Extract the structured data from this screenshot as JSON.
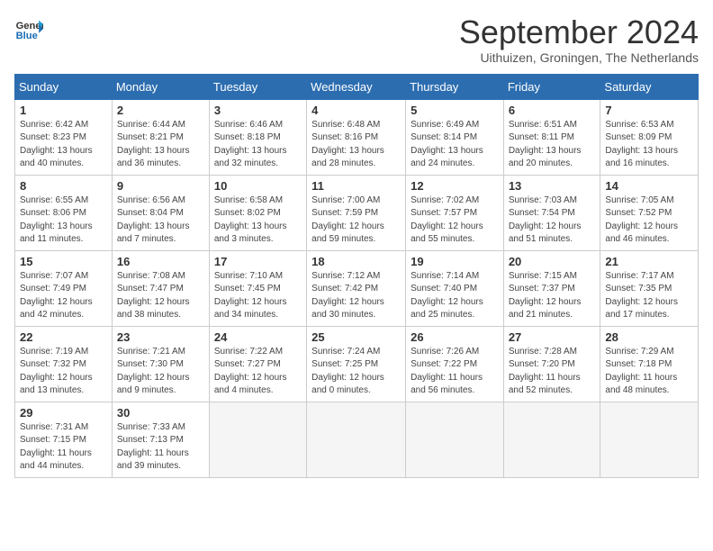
{
  "header": {
    "logo_line1": "General",
    "logo_line2": "Blue",
    "month_year": "September 2024",
    "location": "Uithuizen, Groningen, The Netherlands"
  },
  "days_of_week": [
    "Sunday",
    "Monday",
    "Tuesday",
    "Wednesday",
    "Thursday",
    "Friday",
    "Saturday"
  ],
  "weeks": [
    [
      {
        "day": 1,
        "detail": "Sunrise: 6:42 AM\nSunset: 8:23 PM\nDaylight: 13 hours\nand 40 minutes."
      },
      {
        "day": 2,
        "detail": "Sunrise: 6:44 AM\nSunset: 8:21 PM\nDaylight: 13 hours\nand 36 minutes."
      },
      {
        "day": 3,
        "detail": "Sunrise: 6:46 AM\nSunset: 8:18 PM\nDaylight: 13 hours\nand 32 minutes."
      },
      {
        "day": 4,
        "detail": "Sunrise: 6:48 AM\nSunset: 8:16 PM\nDaylight: 13 hours\nand 28 minutes."
      },
      {
        "day": 5,
        "detail": "Sunrise: 6:49 AM\nSunset: 8:14 PM\nDaylight: 13 hours\nand 24 minutes."
      },
      {
        "day": 6,
        "detail": "Sunrise: 6:51 AM\nSunset: 8:11 PM\nDaylight: 13 hours\nand 20 minutes."
      },
      {
        "day": 7,
        "detail": "Sunrise: 6:53 AM\nSunset: 8:09 PM\nDaylight: 13 hours\nand 16 minutes."
      }
    ],
    [
      {
        "day": 8,
        "detail": "Sunrise: 6:55 AM\nSunset: 8:06 PM\nDaylight: 13 hours\nand 11 minutes."
      },
      {
        "day": 9,
        "detail": "Sunrise: 6:56 AM\nSunset: 8:04 PM\nDaylight: 13 hours\nand 7 minutes."
      },
      {
        "day": 10,
        "detail": "Sunrise: 6:58 AM\nSunset: 8:02 PM\nDaylight: 13 hours\nand 3 minutes."
      },
      {
        "day": 11,
        "detail": "Sunrise: 7:00 AM\nSunset: 7:59 PM\nDaylight: 12 hours\nand 59 minutes."
      },
      {
        "day": 12,
        "detail": "Sunrise: 7:02 AM\nSunset: 7:57 PM\nDaylight: 12 hours\nand 55 minutes."
      },
      {
        "day": 13,
        "detail": "Sunrise: 7:03 AM\nSunset: 7:54 PM\nDaylight: 12 hours\nand 51 minutes."
      },
      {
        "day": 14,
        "detail": "Sunrise: 7:05 AM\nSunset: 7:52 PM\nDaylight: 12 hours\nand 46 minutes."
      }
    ],
    [
      {
        "day": 15,
        "detail": "Sunrise: 7:07 AM\nSunset: 7:49 PM\nDaylight: 12 hours\nand 42 minutes."
      },
      {
        "day": 16,
        "detail": "Sunrise: 7:08 AM\nSunset: 7:47 PM\nDaylight: 12 hours\nand 38 minutes."
      },
      {
        "day": 17,
        "detail": "Sunrise: 7:10 AM\nSunset: 7:45 PM\nDaylight: 12 hours\nand 34 minutes."
      },
      {
        "day": 18,
        "detail": "Sunrise: 7:12 AM\nSunset: 7:42 PM\nDaylight: 12 hours\nand 30 minutes."
      },
      {
        "day": 19,
        "detail": "Sunrise: 7:14 AM\nSunset: 7:40 PM\nDaylight: 12 hours\nand 25 minutes."
      },
      {
        "day": 20,
        "detail": "Sunrise: 7:15 AM\nSunset: 7:37 PM\nDaylight: 12 hours\nand 21 minutes."
      },
      {
        "day": 21,
        "detail": "Sunrise: 7:17 AM\nSunset: 7:35 PM\nDaylight: 12 hours\nand 17 minutes."
      }
    ],
    [
      {
        "day": 22,
        "detail": "Sunrise: 7:19 AM\nSunset: 7:32 PM\nDaylight: 12 hours\nand 13 minutes."
      },
      {
        "day": 23,
        "detail": "Sunrise: 7:21 AM\nSunset: 7:30 PM\nDaylight: 12 hours\nand 9 minutes."
      },
      {
        "day": 24,
        "detail": "Sunrise: 7:22 AM\nSunset: 7:27 PM\nDaylight: 12 hours\nand 4 minutes."
      },
      {
        "day": 25,
        "detail": "Sunrise: 7:24 AM\nSunset: 7:25 PM\nDaylight: 12 hours\nand 0 minutes."
      },
      {
        "day": 26,
        "detail": "Sunrise: 7:26 AM\nSunset: 7:22 PM\nDaylight: 11 hours\nand 56 minutes."
      },
      {
        "day": 27,
        "detail": "Sunrise: 7:28 AM\nSunset: 7:20 PM\nDaylight: 11 hours\nand 52 minutes."
      },
      {
        "day": 28,
        "detail": "Sunrise: 7:29 AM\nSunset: 7:18 PM\nDaylight: 11 hours\nand 48 minutes."
      }
    ],
    [
      {
        "day": 29,
        "detail": "Sunrise: 7:31 AM\nSunset: 7:15 PM\nDaylight: 11 hours\nand 44 minutes."
      },
      {
        "day": 30,
        "detail": "Sunrise: 7:33 AM\nSunset: 7:13 PM\nDaylight: 11 hours\nand 39 minutes."
      },
      null,
      null,
      null,
      null,
      null
    ]
  ]
}
